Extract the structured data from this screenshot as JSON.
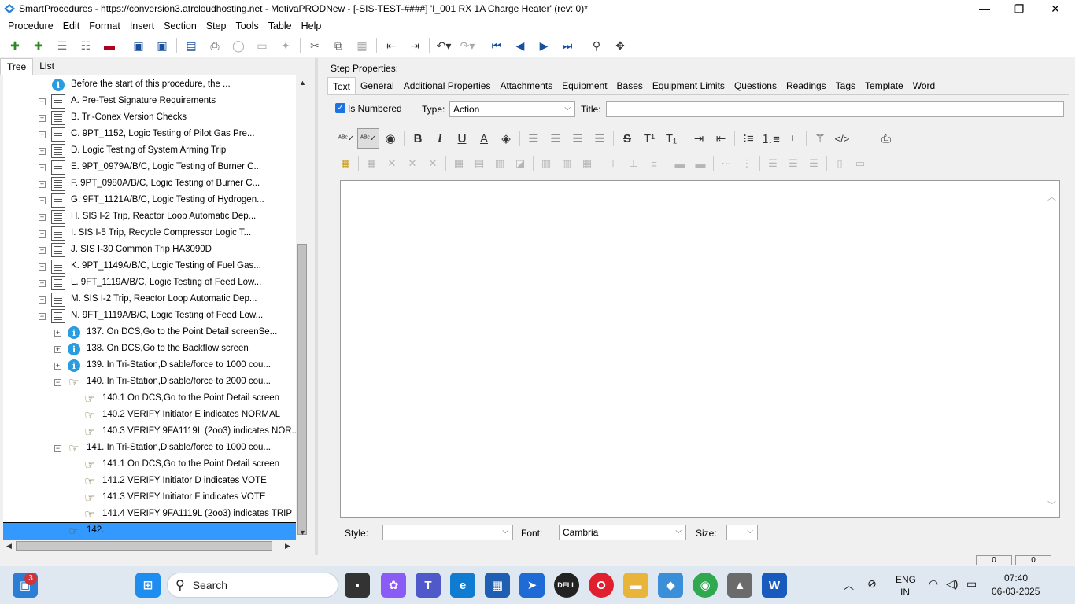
{
  "window": {
    "title": "SmartProcedures - https://conversion3.atrcloudhosting.net - MotivaPRODNew - [-SIS-TEST-####] 'I_001 RX 1A Charge Heater' (rev: 0)*"
  },
  "menu": [
    "Procedure",
    "Edit",
    "Format",
    "Insert",
    "Section",
    "Step",
    "Tools",
    "Table",
    "Help"
  ],
  "left_tabs": [
    "Tree",
    "List"
  ],
  "tree": [
    {
      "label": "Before the start of this procedure, the ...",
      "icon": "info",
      "expander": "",
      "level": 0
    },
    {
      "label": "A. Pre-Test Signature Requirements",
      "icon": "doc",
      "expander": "+",
      "level": 0
    },
    {
      "label": "B. Tri-Conex Version Checks",
      "icon": "doc",
      "expander": "+",
      "level": 0
    },
    {
      "label": "C. 9PT_1152, Logic Testing of Pilot Gas Pre...",
      "icon": "doc",
      "expander": "+",
      "level": 0
    },
    {
      "label": "D. Logic Testing of System Arming Trip",
      "icon": "doc",
      "expander": "+",
      "level": 0
    },
    {
      "label": "E. 9PT_0979A/B/C, Logic Testing of Burner C...",
      "icon": "doc",
      "expander": "+",
      "level": 0
    },
    {
      "label": "F. 9PT_0980A/B/C, Logic Testing of Burner C...",
      "icon": "doc",
      "expander": "+",
      "level": 0
    },
    {
      "label": "G. 9FT_1121A/B/C, Logic Testing of Hydrogen...",
      "icon": "doc",
      "expander": "+",
      "level": 0
    },
    {
      "label": "H. SIS I-2 Trip, Reactor Loop Automatic Dep...",
      "icon": "doc",
      "expander": "+",
      "level": 0
    },
    {
      "label": "I. SIS I-5 Trip, Recycle Compressor Logic T...",
      "icon": "doc",
      "expander": "+",
      "level": 0
    },
    {
      "label": "J. SIS I-30 Common Trip HA3090D",
      "icon": "doc",
      "expander": "+",
      "level": 0
    },
    {
      "label": "K. 9PT_1149A/B/C, Logic Testing of Fuel Gas...",
      "icon": "doc",
      "expander": "+",
      "level": 0
    },
    {
      "label": "L. 9FT_1119A/B/C, Logic Testing of Feed Low...",
      "icon": "doc",
      "expander": "+",
      "level": 0
    },
    {
      "label": "M. SIS I-2 Trip, Reactor Loop Automatic Dep...",
      "icon": "doc",
      "expander": "+",
      "level": 0
    },
    {
      "label": "N. 9FT_1119A/B/C, Logic Testing of Feed Low...",
      "icon": "doc",
      "expander": "−",
      "level": 0
    },
    {
      "label": "137. On DCS,Go to the Point Detail screenSe...",
      "icon": "info",
      "expander": "+",
      "level": 1
    },
    {
      "label": "138. On DCS,Go to the Backflow screen",
      "icon": "info",
      "expander": "+",
      "level": 1
    },
    {
      "label": "139. In Tri-Station,Disable/force to 1000 cou...",
      "icon": "info",
      "expander": "+",
      "level": 1
    },
    {
      "label": "140. In Tri-Station,Disable/force to 2000 cou...",
      "icon": "hand",
      "expander": "−",
      "level": 1
    },
    {
      "label": "140.1 On DCS,Go to the Point Detail screen",
      "icon": "hand",
      "expander": "",
      "level": 2
    },
    {
      "label": "140.2 VERIFY Initiator E indicates NORMAL",
      "icon": "hand",
      "expander": "",
      "level": 2
    },
    {
      "label": "140.3 VERIFY 9FA1119L (2oo3) indicates NOR...",
      "icon": "hand",
      "expander": "",
      "level": 2
    },
    {
      "label": "141. In Tri-Station,Disable/force to 1000 cou...",
      "icon": "hand",
      "expander": "−",
      "level": 1
    },
    {
      "label": "141.1 On DCS,Go to the Point Detail screen",
      "icon": "hand",
      "expander": "",
      "level": 2
    },
    {
      "label": "141.2 VERIFY Initiator D indicates VOTE",
      "icon": "hand",
      "expander": "",
      "level": 2
    },
    {
      "label": "141.3 VERIFY Initiator F indicates VOTE",
      "icon": "hand",
      "expander": "",
      "level": 2
    },
    {
      "label": "141.4 VERIFY 9FA1119L (2oo3) indicates TRIP",
      "icon": "hand",
      "expander": "",
      "level": 2
    },
    {
      "label": "142.",
      "icon": "hand",
      "expander": "",
      "level": 1,
      "selected": true
    }
  ],
  "step_props": {
    "heading": "Step Properties:",
    "tabs": [
      "Text",
      "General",
      "Additional Properties",
      "Attachments",
      "Equipment",
      "Bases",
      "Equipment Limits",
      "Questions",
      "Readings",
      "Tags",
      "Template",
      "Word"
    ],
    "is_numbered_label": "Is Numbered",
    "type_label": "Type:",
    "type_value": "Action",
    "title_label": "Title:",
    "title_value": "",
    "style_label": "Style:",
    "style_value": "",
    "font_label": "Font:",
    "font_value": "Cambria",
    "size_label": "Size:",
    "size_value": ""
  },
  "format_toolbar": [
    "spellcheck",
    "spellcheck-as-you-type",
    "hide",
    "B",
    "I",
    "U",
    "A",
    "fill",
    "align-left",
    "align-center",
    "align-right",
    "justify",
    "S",
    "T¹",
    "T₁",
    "indent",
    "outdent",
    "bullets",
    "numbering",
    "plus-minus",
    "magic",
    "</>",
    "print"
  ],
  "status": {
    "left_value": "0",
    "right_value": "0"
  },
  "taskbar": {
    "search_label": "Search",
    "notification_count": "3",
    "lang_top": "ENG",
    "lang_bottom": "IN",
    "time": "07:40",
    "date": "06-03-2025"
  },
  "colors": {
    "selection": "#3399ff",
    "info_icon": "#2a9de0",
    "accent_blue": "#1a4f9c"
  }
}
